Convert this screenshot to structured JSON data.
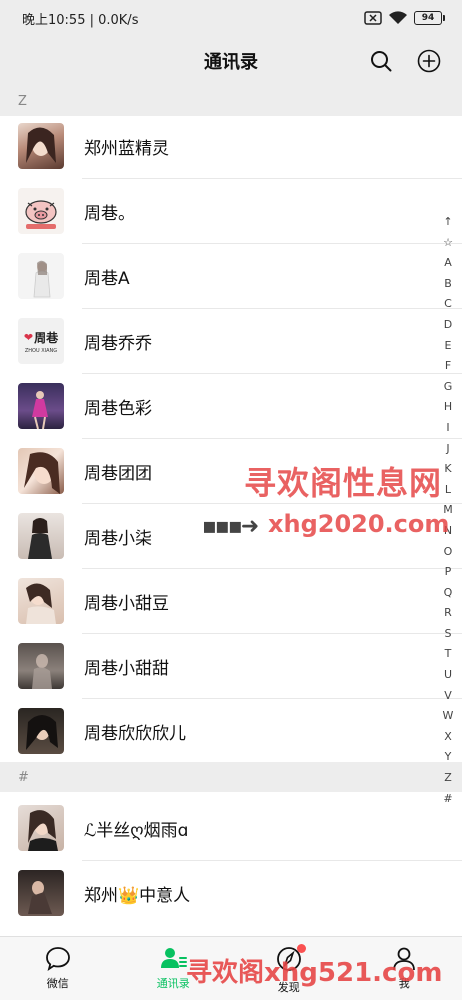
{
  "status_bar": {
    "time_speed": "晚上10:55 | 0.0K/s",
    "battery": "94"
  },
  "header": {
    "title": "通讯录"
  },
  "sections": [
    {
      "letter": "Z",
      "contacts": [
        {
          "name": "郑州蓝精灵"
        },
        {
          "name": "周巷。"
        },
        {
          "name": "周巷A"
        },
        {
          "name": "周巷乔乔",
          "avatar_text": "周巷",
          "avatar_subtext": "ZHOU XIANG"
        },
        {
          "name": "周巷色彩"
        },
        {
          "name": "周巷团团"
        },
        {
          "name": "周巷小柒"
        },
        {
          "name": "周巷小甜豆"
        },
        {
          "name": "周巷小甜甜"
        },
        {
          "name": "周巷欣欣欣儿"
        }
      ]
    },
    {
      "letter": "#",
      "contacts": [
        {
          "name": "ℒ半丝ღ烟雨ɑ"
        },
        {
          "name": "郑州👑中意人"
        }
      ]
    }
  ],
  "index_bar": [
    "↑",
    "☆",
    "A",
    "B",
    "C",
    "D",
    "E",
    "F",
    "G",
    "H",
    "I",
    "J",
    "K",
    "L",
    "M",
    "N",
    "O",
    "P",
    "Q",
    "R",
    "S",
    "T",
    "U",
    "V",
    "W",
    "X",
    "Y",
    "Z",
    "#"
  ],
  "watermarks": {
    "line1": "寻欢阁性息网",
    "line2": "xhg2020.com",
    "line3": "寻欢阁xhg521.com"
  },
  "bottom_nav": [
    {
      "label": "微信",
      "icon": "chat-icon",
      "active": false
    },
    {
      "label": "通讯录",
      "icon": "contacts-icon",
      "active": true
    },
    {
      "label": "发现",
      "icon": "compass-icon",
      "active": false
    },
    {
      "label": "我",
      "icon": "person-icon",
      "active": false
    }
  ],
  "colors": {
    "accent": "#07c160",
    "background": "#ededed",
    "watermark": "#e54646"
  }
}
